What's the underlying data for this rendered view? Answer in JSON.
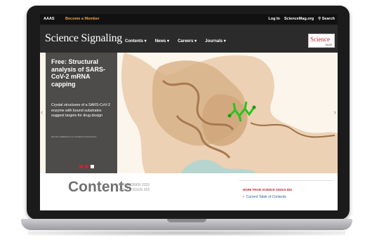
{
  "topbar": {
    "aaas": "AAAS",
    "member": "Become a Member",
    "login": "Log In",
    "sciencemag": "ScienceMag.org",
    "search": "Search"
  },
  "nav": {
    "brand": "Science Signaling",
    "menu": [
      {
        "label": "Contents"
      },
      {
        "label": "News"
      },
      {
        "label": "Careers"
      },
      {
        "label": "Journals"
      }
    ],
    "logo_word": "Science",
    "logo_sub": "AAAS"
  },
  "hero": {
    "title": "Free: Structural analysis of SARS-CoV-2 mRNA capping",
    "text": "Crystal structures of a SARS-CoV-2 enzyme with bound substrates suggest targets for drug design",
    "credit": "ROHAN LEBEDE ET AL./SCIENCE SIGNALING",
    "colors": {
      "panel": "#3a3a3a",
      "protein": "#c9a47e",
      "ligand": "#27c41d",
      "dots": [
        "#c1272d",
        "#c1272d",
        "#ffffff"
      ]
    }
  },
  "main": {
    "title": "Contents",
    "date": "06 OCTOBER 2020",
    "issue": "VOL 13, ISSUE 652",
    "more_heading": "MORE FROM SCIENCE SIGNALING",
    "current_link": "Current Table of Contents"
  }
}
